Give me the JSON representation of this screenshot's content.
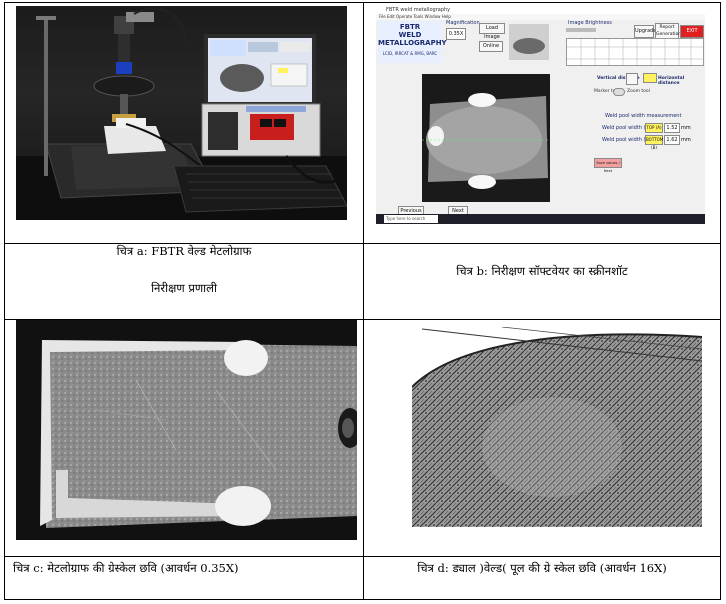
{
  "captions": {
    "a_line1": "चित्र a: FBTR वेल्ड मेटलोग्राफ",
    "a_line2": "निरीक्षण प्रणाली",
    "b": "चित्र b: निरीक्षण सॉफ्टवेयर का स्क्रीनशॉट",
    "c": "चित्र c: मेटलोग्राफ की ग्रेस्केल छवि (आवर्धन 0.35X)",
    "d": "चित्र d: ड्याल )वेल्ड( पूल की ग्रे स्केल छवि (आवर्धन 16X)"
  },
  "software": {
    "window_title": "FBTR weld metallography",
    "menu": "File  Edit  Operate  Tools  Window  Help",
    "logo_line1": "FBTR",
    "logo_line2": "WELD",
    "logo_line3": "METALLOGRAPHY",
    "logo_sub": "LCID, IRRCAT & RMG, BARC",
    "magnification_label": "Magnification",
    "magnification_value": "0.35X",
    "load_image": "Load Image",
    "online": "Online",
    "image_brightness": "Image Brightness",
    "upgrade": "Upgrade",
    "report": "Report Generation",
    "exit": "EXIT",
    "vertical_distance": "Vertical distance",
    "horizontal_distance": "Horizontal distance",
    "marker_tool": "Marker tool",
    "zoom_tool": "Zoom tool",
    "weld_pool_title": "Weld pool width measurement",
    "width_a_label": "Weld pool width (A)",
    "width_b_label": "Weld pool width (B)",
    "top_label": "TOP (A)",
    "bottom_label": "BOTTOM (B)",
    "width_a_value": "1.52",
    "width_b_value": "1.62",
    "unit": "mm",
    "save_button": "Save values / Next",
    "previous": "Previous",
    "next": "Next",
    "search": "Type here to search"
  },
  "colors": {
    "border": "#000000",
    "logo_text": "#1a2a6c",
    "yellow": "#fff25e",
    "red": "#e02020"
  }
}
